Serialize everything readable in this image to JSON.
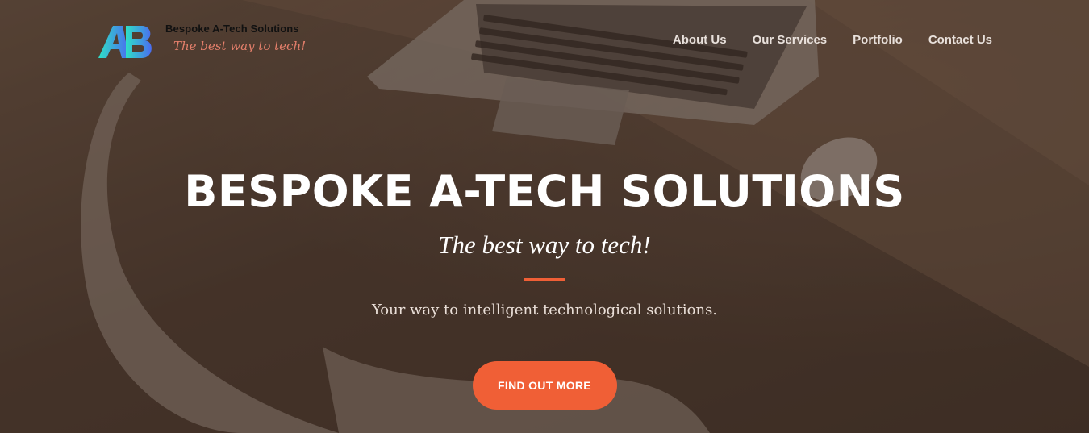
{
  "header": {
    "brand_name": "Bespoke A-Tech Solutions",
    "brand_slogan": "The best way to tech!",
    "logo_letters": "AB"
  },
  "nav": {
    "items": [
      {
        "label": "About Us"
      },
      {
        "label": "Our Services"
      },
      {
        "label": "Portfolio"
      },
      {
        "label": "Contact Us"
      }
    ]
  },
  "hero": {
    "title": "BESPOKE A-TECH SOLUTIONS",
    "tagline": "The best way to tech!",
    "subtitle": "Your way to intelligent technological solutions.",
    "cta_label": "FIND OUT MORE"
  },
  "colors": {
    "accent": "#f05f36",
    "logo_gradient_start": "#2ee0c6",
    "logo_gradient_end": "#4b6cf0",
    "slogan_color": "#e47f6b"
  }
}
